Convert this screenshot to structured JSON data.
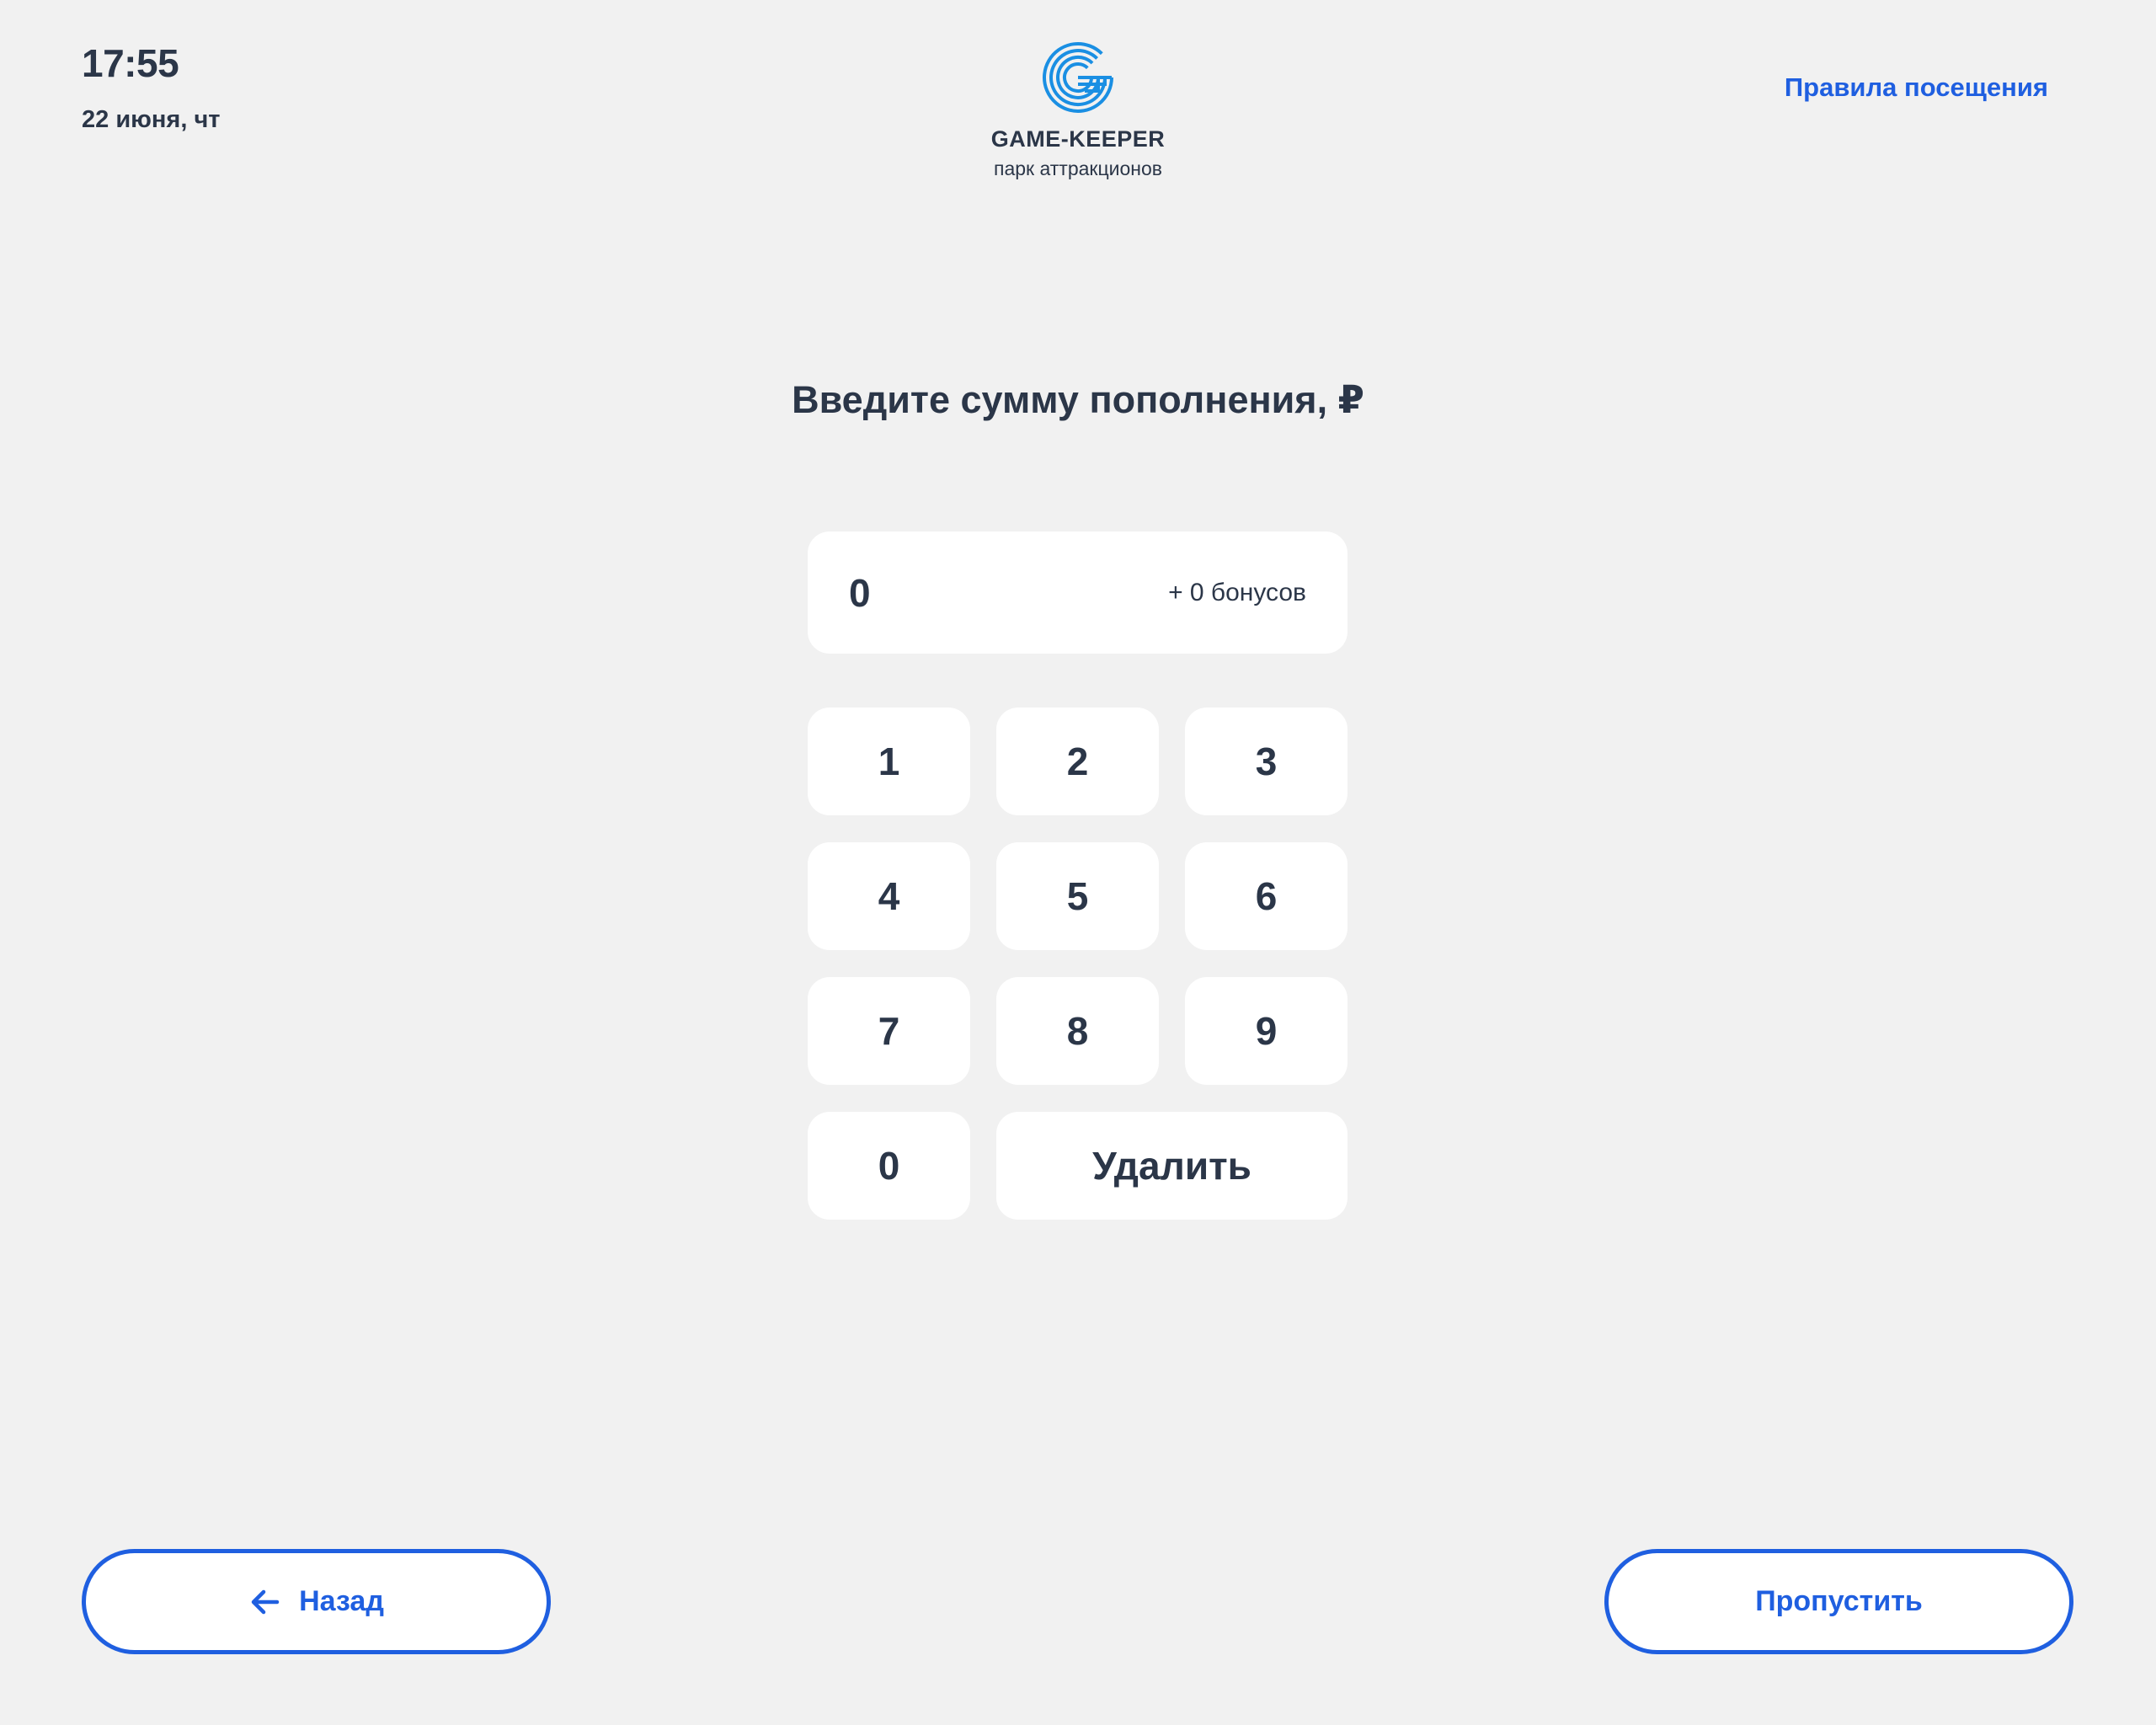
{
  "header": {
    "time": "17:55",
    "date": "22 июня, чт",
    "rules_link": "Правила посещения"
  },
  "logo": {
    "icon": "game-keeper-logo-icon",
    "name": "GAME-KEEPER",
    "subtitle": "парк аттракционов"
  },
  "main": {
    "prompt": "Введите сумму пополнения, ₽",
    "amount_field": {
      "value": "0",
      "bonus": "+ 0 бонусов"
    },
    "keypad": {
      "keys": [
        "1",
        "2",
        "3",
        "4",
        "5",
        "6",
        "7",
        "8",
        "9",
        "0"
      ],
      "delete_label": "Удалить"
    }
  },
  "footer": {
    "back_label": "Назад",
    "back_icon": "arrow-left-icon",
    "skip_label": "Пропустить"
  },
  "colors": {
    "accent": "#1f5fe0",
    "logo": "#1a8fe3",
    "text": "#2b3648",
    "background": "#f1f1f1",
    "surface": "#ffffff"
  }
}
